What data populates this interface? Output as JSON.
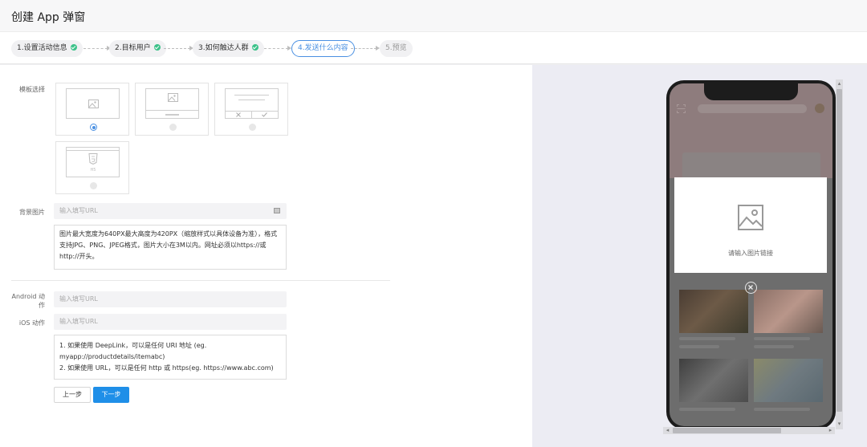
{
  "header": {
    "title": "创建 App 弹窗"
  },
  "steps": [
    {
      "label": "1.设置活动信息",
      "status": "done"
    },
    {
      "label": "2.目标用户",
      "status": "done"
    },
    {
      "label": "3.如何触达人群",
      "status": "done"
    },
    {
      "label": "4.发送什么内容",
      "status": "active"
    },
    {
      "label": "5.预览",
      "status": "pending"
    }
  ],
  "form": {
    "template_label": "模板选择",
    "templates": [
      {
        "name": "image",
        "selected": true
      },
      {
        "name": "image-with-bar",
        "selected": false
      },
      {
        "name": "text-confirm",
        "selected": false
      },
      {
        "name": "html5",
        "selected": false,
        "badge": "H5"
      }
    ],
    "background_label": "背景图片",
    "background_placeholder": "输入填写URL",
    "background_hint": "图片最大宽度为640PX最大高度为420PX（缩放样式以具体设备为准），格式支持JPG、PNG、JPEG格式，图片大小在3M以内。网址必须以https://或http://开头。",
    "android_label": "Android 动作",
    "android_placeholder": "输入填写URL",
    "ios_label": "iOS 动作",
    "ios_placeholder": "输入填写URL",
    "action_hint_1": "1. 如果使用 DeepLink，可以是任何 URI 地址 (eg. myapp://productdetails/itemabc)",
    "action_hint_2": "2. 如果使用 URL，可以是任何 http 或 https(eg. https://www.abc.com)",
    "prev_button": "上一步",
    "next_button": "下一步"
  },
  "preview": {
    "popup_text": "请输入图片链接"
  },
  "colors": {
    "accent": "#4a90e2",
    "primary_button": "#1f8fe8",
    "success": "#3dc28a"
  }
}
